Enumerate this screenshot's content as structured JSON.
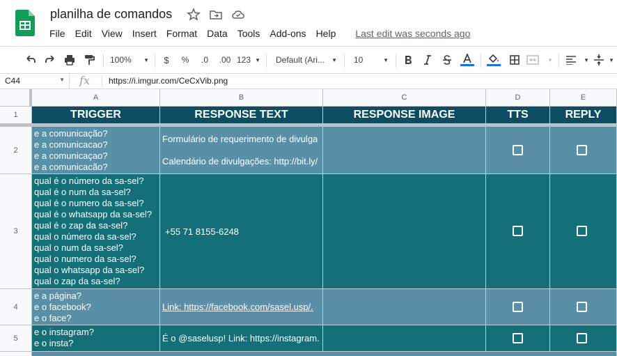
{
  "doc": {
    "title": "planilha de comandos",
    "menus": [
      "File",
      "Edit",
      "View",
      "Insert",
      "Format",
      "Data",
      "Tools",
      "Add-ons",
      "Help"
    ],
    "last_edit": "Last edit was seconds ago"
  },
  "toolbar": {
    "zoom": "100%",
    "currency": "$",
    "percent": "%",
    "dec_decrease": ".0",
    "dec_increase": ".00",
    "number_format": "123",
    "font": "Default (Ari...",
    "font_size": "10"
  },
  "formula_bar": {
    "cell_ref": "C44",
    "fx": "fx",
    "value": "https://i.imgur.com/CeCxVib.png"
  },
  "columns": [
    "A",
    "B",
    "C",
    "D",
    "E"
  ],
  "row_numbers": [
    "1",
    "2",
    "3",
    "4",
    "5"
  ],
  "headers": {
    "trigger": "TRIGGER",
    "response_text": "RESPONSE TEXT",
    "response_image": "RESPONSE IMAGE",
    "tts": "TTS",
    "reply": "REPLY"
  },
  "rows": [
    {
      "trigger": [
        "e a comunicação?",
        "e a comunicacao?",
        "e a comunicaçao?",
        "e a comunicacão?"
      ],
      "response": [
        "Formulário de requerimento de divulga",
        "",
        "Calendário de divulgações: http://bit.ly/"
      ]
    },
    {
      "trigger": [
        "qual é o número da sa-sel?",
        "qual é o num da sa-sel?",
        "qual é o numero da sa-sel?",
        "qual é o whatsapp da sa-sel?",
        "qual é o zap da sa-sel?",
        "qual o número da sa-sel?",
        "qual o num da sa-sel?",
        "qual o numero da sa-sel?",
        "qual o whatsapp da sa-sel?",
        "qual o zap da sa-sel?"
      ],
      "response": [
        "+55 71 8155-6248"
      ]
    },
    {
      "trigger": [
        "e a página?",
        "e o facebook?",
        "e o face?"
      ],
      "response": [
        "Link: https://facebook.com/sasel.usp/."
      ]
    },
    {
      "trigger": [
        "e o instagram?",
        "e o insta?"
      ],
      "response": [
        "É o @saselusp! Link: https://instagram."
      ]
    }
  ],
  "colors": {
    "header_bg": "#0d4d62",
    "row_light": "#5a8fa8",
    "row_dark": "#146f78",
    "sheets_green": "#0f9d58"
  }
}
